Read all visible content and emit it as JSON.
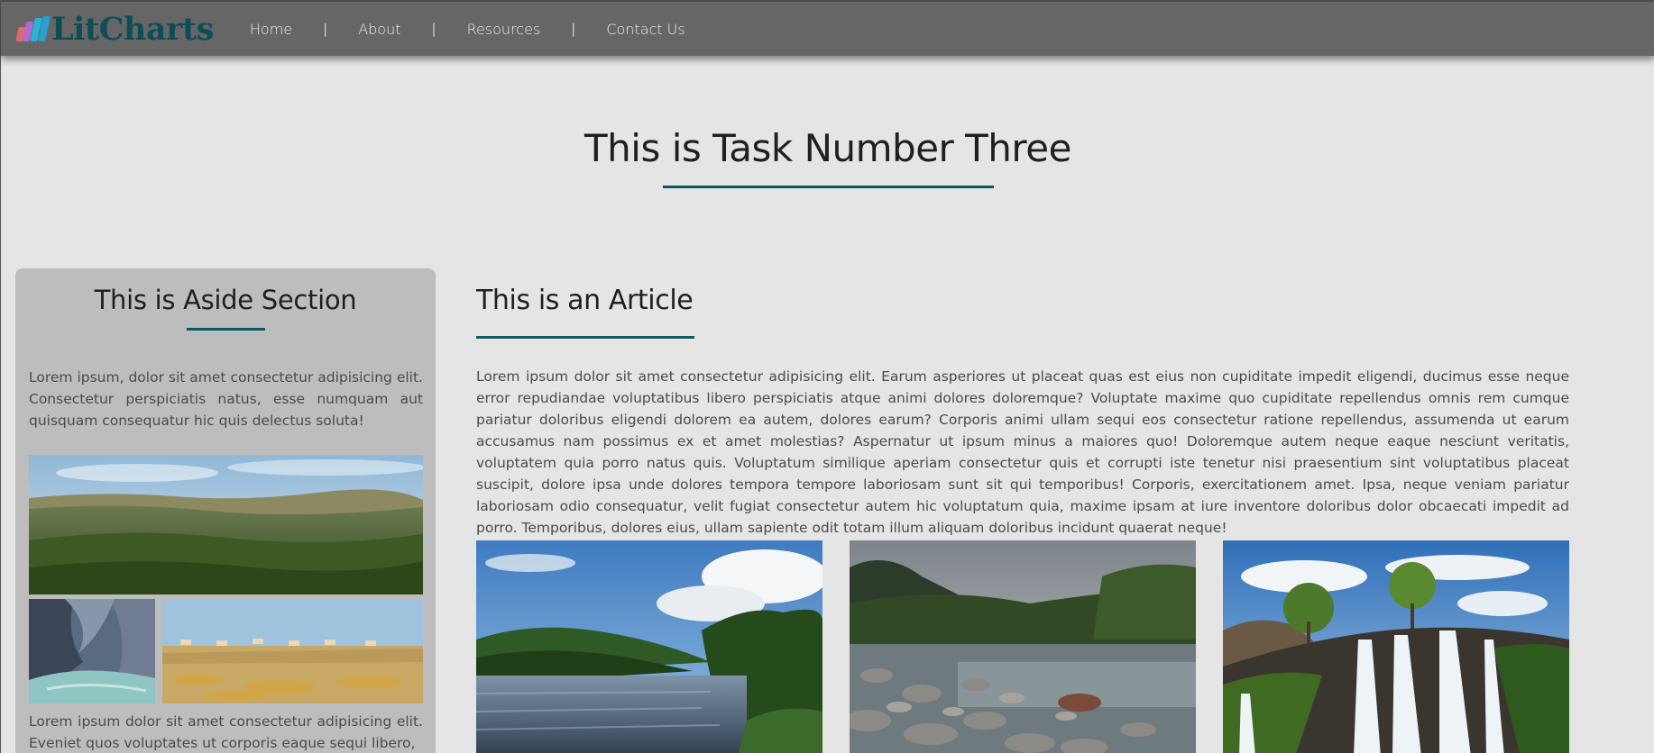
{
  "brand": {
    "name": "LitCharts",
    "colors": {
      "bar1": "#e06a6a",
      "bar2": "#b06ad0",
      "bar3": "#2bb3d6",
      "bar4": "#2a9fd0",
      "text": "#0e4d55"
    }
  },
  "nav": {
    "items": [
      {
        "label": "Home"
      },
      {
        "label": "About"
      },
      {
        "label": "Resources"
      },
      {
        "label": "Contact Us"
      }
    ],
    "separator": "|"
  },
  "page": {
    "title": "This is Task Number Three",
    "accent": "#0e5a60",
    "background": "#e5e5e5",
    "navbar_color": "#666666"
  },
  "aside": {
    "title": "This is Aside Section",
    "paragraph1": "Lorem ipsum, dolor sit amet consectetur adipisicing elit. Consectetur perspiciatis natus, esse numquam aut quisquam consequatur hic quis delectus soluta!",
    "paragraph2": "Lorem ipsum dolor sit amet consectetur adipisicing elit. Eveniet quos voluptates ut corporis eaque sequi libero,",
    "images": [
      "forest-hills-image",
      "canyon-image",
      "savanna-antelope-image"
    ]
  },
  "article": {
    "title": "This is an Article",
    "paragraph": "Lorem ipsum dolor sit amet consectetur adipisicing elit. Earum asperiores ut placeat quas est eius non cupiditate impedit eligendi, ducimus esse neque error repudiandae voluptatibus libero perspiciatis atque animi dolores doloremque? Voluptate maxime quo cupiditate repellendus omnis rem cumque pariatur doloribus eligendi dolorem ea autem, dolores earum? Corporis animi ullam sequi eos consectetur ratione repellendus, assumenda ut earum accusamus nam possimus ex et amet molestias? Aspernatur ut ipsum minus a maiores quo! Doloremque autem neque eaque nesciunt veritatis, voluptatem quia porro natus quis. Voluptatum similique aperiam consectetur quis et corrupti iste tenetur nisi praesentium sint voluptatibus placeat suscipit, dolore ipsa unde dolores tempora tempore laboriosam sunt sit qui temporibus! Corporis, exercitationem amet. Ipsa, neque veniam pariatur laboriosam odio consequatur, velit fugiat consectetur autem hic voluptatum quia, maxime ipsam at iure inventore doloribus dolor obcaecati impedit ad porro. Temporibus, dolores eius, ullam sapiente odit totam illum aliquam doloribus incidunt quaerat neque!",
    "images": [
      "river-landscape-image",
      "rocky-stream-image",
      "waterfall-image"
    ]
  }
}
